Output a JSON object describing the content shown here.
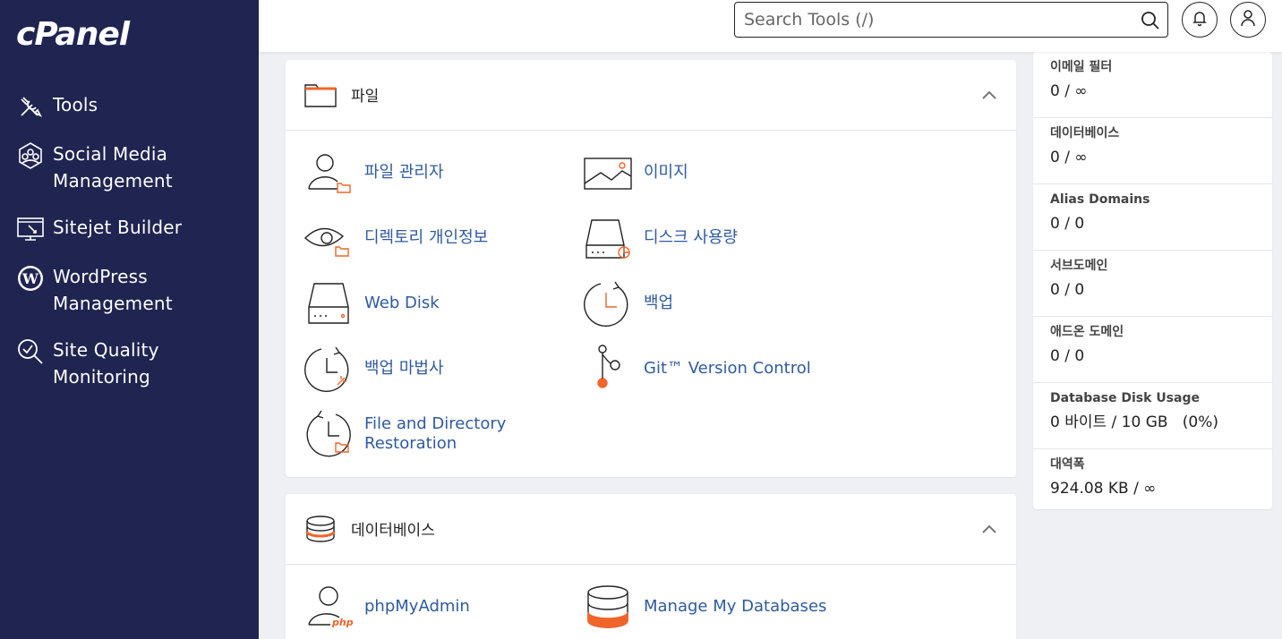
{
  "brand": {
    "logo_text": "cPanel"
  },
  "sidebar": {
    "items": [
      {
        "label": "Tools",
        "icon": "tools-icon"
      },
      {
        "label": "Social Media Management",
        "icon": "social-media-icon"
      },
      {
        "label": "Sitejet Builder",
        "icon": "sitejet-icon"
      },
      {
        "label": "WordPress Management",
        "icon": "wordpress-icon"
      },
      {
        "label": "Site Quality Monitoring",
        "icon": "site-quality-icon"
      }
    ]
  },
  "header": {
    "search_placeholder": "Search Tools (/)",
    "notifications_icon": "bell-icon",
    "user_icon": "user-icon"
  },
  "files_section": {
    "title": "파일",
    "tools": [
      {
        "label": "파일 관리자",
        "icon": "file-manager-icon"
      },
      {
        "label": "이미지",
        "icon": "images-icon"
      },
      {
        "label": "디렉토리 개인정보",
        "icon": "directory-privacy-icon"
      },
      {
        "label": "디스크 사용량",
        "icon": "disk-usage-icon"
      },
      {
        "label": "Web Disk",
        "icon": "web-disk-icon"
      },
      {
        "label": "백업",
        "icon": "backup-icon"
      },
      {
        "label": "백업 마법사",
        "icon": "backup-wizard-icon"
      },
      {
        "label": "Git™ Version Control",
        "icon": "git-icon"
      },
      {
        "label": "File and Directory Restoration",
        "icon": "restoration-icon"
      }
    ]
  },
  "databases_section": {
    "title": "데이터베이스",
    "tools": [
      {
        "label": "phpMyAdmin",
        "icon": "phpmyadmin-icon"
      },
      {
        "label": "Manage My Databases",
        "icon": "manage-databases-icon"
      }
    ]
  },
  "stats": [
    {
      "label": "이메일 필터",
      "value": "0 / ∞"
    },
    {
      "label": "데이터베이스",
      "value": "0 / ∞"
    },
    {
      "label": "Alias Domains",
      "value": "0 / 0"
    },
    {
      "label": "서브도메인",
      "value": "0 / 0"
    },
    {
      "label": "애드온 도메인",
      "value": "0 / 0"
    },
    {
      "label": "Database Disk Usage",
      "value": "0 바이트 / 10 GB   (0%)"
    },
    {
      "label": "대역폭",
      "value": "924.08 KB / ∞"
    }
  ],
  "colors": {
    "sidebar_bg": "#1f2451",
    "accent_orange": "#f0652a",
    "link_blue": "#2f5aa0"
  }
}
